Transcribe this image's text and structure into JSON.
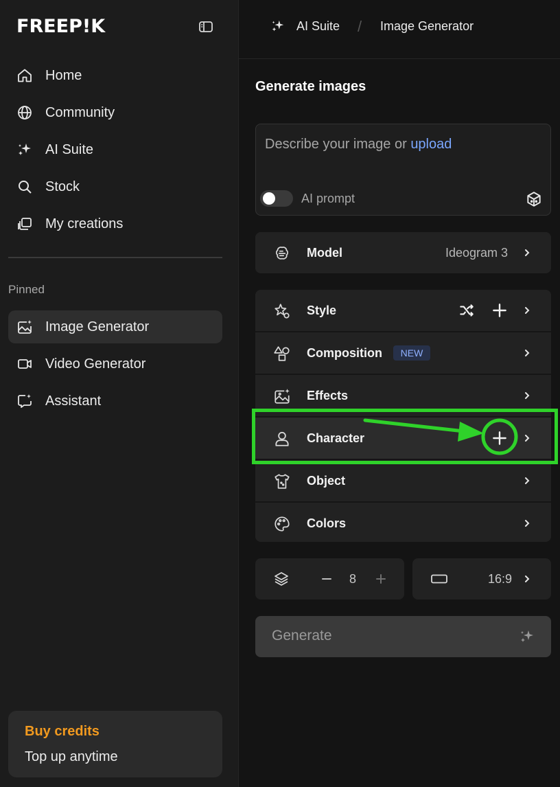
{
  "sidebar": {
    "logo": "FREEP!K",
    "nav": [
      {
        "label": "Home",
        "icon": "home-icon"
      },
      {
        "label": "Community",
        "icon": "globe-icon"
      },
      {
        "label": "AI Suite",
        "icon": "sparkles-icon"
      },
      {
        "label": "Stock",
        "icon": "search-icon"
      },
      {
        "label": "My creations",
        "icon": "creations-icon"
      }
    ],
    "pinned_label": "Pinned",
    "pinned": [
      {
        "label": "Image Generator",
        "icon": "image-sparkle-icon",
        "active": true
      },
      {
        "label": "Video Generator",
        "icon": "video-icon"
      },
      {
        "label": "Assistant",
        "icon": "chat-sparkle-icon"
      }
    ],
    "credits": {
      "title": "Buy credits",
      "subtitle": "Top up anytime"
    }
  },
  "breadcrumb": {
    "parent": "AI Suite",
    "separator": "/",
    "current": "Image Generator"
  },
  "main": {
    "title": "Generate images",
    "prompt": {
      "placeholder": "Describe your image or ",
      "link": "upload",
      "toggle_label": "AI prompt",
      "toggle_on": false
    },
    "model": {
      "label": "Model",
      "value": "Ideogram 3"
    },
    "options": [
      {
        "label": "Style",
        "icon": "star-shapes-icon"
      },
      {
        "label": "Composition",
        "icon": "shapes-icon",
        "badge": "NEW"
      },
      {
        "label": "Effects",
        "icon": "image-sparkle-icon"
      },
      {
        "label": "Character",
        "icon": "person-icon"
      },
      {
        "label": "Object",
        "icon": "shirt-icon"
      },
      {
        "label": "Colors",
        "icon": "palette-icon"
      }
    ],
    "quantity": {
      "value": "8",
      "minus": "−",
      "plus": "+"
    },
    "aspect_ratio": {
      "value": "16:9"
    },
    "generate_label": "Generate"
  },
  "colors": {
    "accent_orange": "#f29a1f",
    "link_blue": "#7ba7ff",
    "annotation_green": "#2fd22a"
  }
}
